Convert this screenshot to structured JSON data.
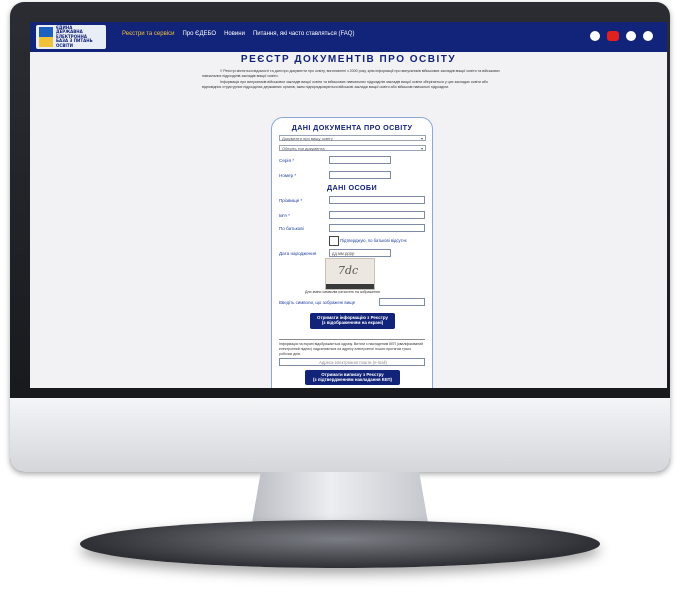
{
  "logo": {
    "text": "ЄДИНА\nДЕРЖАВНА\nЕЛЕКТРОННА\nБАЗА З ПИТАНЬ\nОСВІТИ"
  },
  "nav": {
    "items": [
      "Реєстри та сервіси",
      "Про ЄДЕБО",
      "Новини",
      "Питання, які часто ставляться (FAQ)"
    ],
    "active_index": 0,
    "icons": [
      "facebook-icon",
      "youtube-icon",
      "low-vision-icon",
      "sound-icon"
    ]
  },
  "page": {
    "title": "РЕЄСТР ДОКУМЕНТІВ ПРО ОСВІТУ",
    "intro_1": "У Реєстрі містяться відомості та дані про документи про освіту, виготовлені з 2000 року, крім інформації про випускників військових закладів вищої освіти та військових навчальних підрозділів закладів вищої освіти.",
    "intro_2": "Інформація про випускників військових закладів вищої освіти та військових навчальних підрозділів закладів вищої освіти зберігається у цих закладах освіти або відповідних структурних підрозділах державних органів, яким підпорядковуються військові заклади вищої освіти або військові навчальні підрозділи."
  },
  "form": {
    "doc_section_title": "ДАНІ ДОКУМЕНТА ПРО ОСВІТУ",
    "doc_kind_select": "Документи про вищу освіту",
    "doc_type_select": "Оберіть тип документа",
    "series_label": "Серія *",
    "number_label": "Номер *",
    "person_section_title": "ДАНІ ОСОБИ",
    "surname_label": "Прізвище *",
    "name_label": "Ім'я *",
    "patronymic_label": "По батькові",
    "no_patronymic_label": "Підтверджую, по батькові відсутнє",
    "birth_label": "Дата народження",
    "birth_placeholder": "дд.мм.рррр",
    "captcha_text": "7dc",
    "captcha_hint": "Для зміни символів натисніть на зображення",
    "captcha_label": "Введіть символи, що зображені вище",
    "get_info_button": "Отримати інформацію з Реєстру\n(з відображенням на екрані)",
    "email_note": "Інформація на екрані відображається одразу. Витяги з накладеним КЕП (кваліфікований електронний підпис) надсилаються на адресу електронної пошти протягом трьох робочих днів.",
    "email_placeholder": "Адреса електронної пошти (e-mail)",
    "get_extract_button": "Отримати виписку з Реєстру\n(з підтвердженням накладання КЕП)"
  },
  "colors": {
    "brand_navy": "#12237a",
    "nav_active": "#f0c23a",
    "form_border": "#8ea6d8"
  }
}
